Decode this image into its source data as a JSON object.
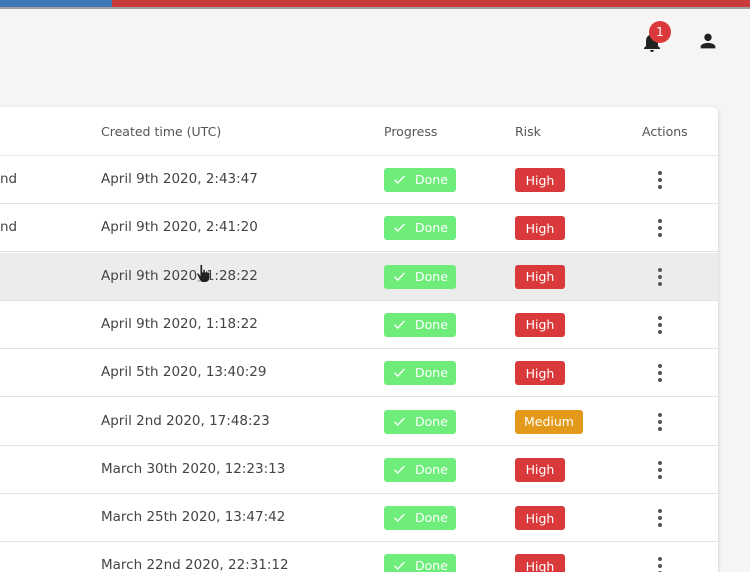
{
  "header": {
    "notification_count": "1",
    "icons": [
      "bell-icon",
      "user-icon"
    ]
  },
  "colors": {
    "top_bar_left": "#3f78b6",
    "top_bar_right": "#c93b3b",
    "done": "#6fed7a",
    "risk_high": "#d9393a",
    "risk_medium": "#e39a1a"
  },
  "table": {
    "columns": {
      "created": "Created time (UTC)",
      "progress": "Progress",
      "risk": "Risk",
      "actions": "Actions"
    },
    "rows": [
      {
        "name": "nd",
        "created": "April 9th 2020, 2:43:47",
        "progress": "Done",
        "risk": "High"
      },
      {
        "name": "nd",
        "created": "April 9th 2020, 2:41:20",
        "progress": "Done",
        "risk": "High"
      },
      {
        "name": "",
        "created": "April 9th 2020, 1:28:22",
        "progress": "Done",
        "risk": "High"
      },
      {
        "name": "",
        "created": "April 9th 2020, 1:18:22",
        "progress": "Done",
        "risk": "High"
      },
      {
        "name": "",
        "created": "April 5th 2020, 13:40:29",
        "progress": "Done",
        "risk": "High"
      },
      {
        "name": "",
        "created": "April 2nd 2020, 17:48:23",
        "progress": "Done",
        "risk": "Medium"
      },
      {
        "name": "",
        "created": "March 30th 2020, 12:23:13",
        "progress": "Done",
        "risk": "High"
      },
      {
        "name": "",
        "created": "March 25th 2020, 13:47:42",
        "progress": "Done",
        "risk": "High"
      },
      {
        "name": "",
        "created": "March 22nd 2020, 22:31:12",
        "progress": "Done",
        "risk": "High"
      }
    ]
  }
}
